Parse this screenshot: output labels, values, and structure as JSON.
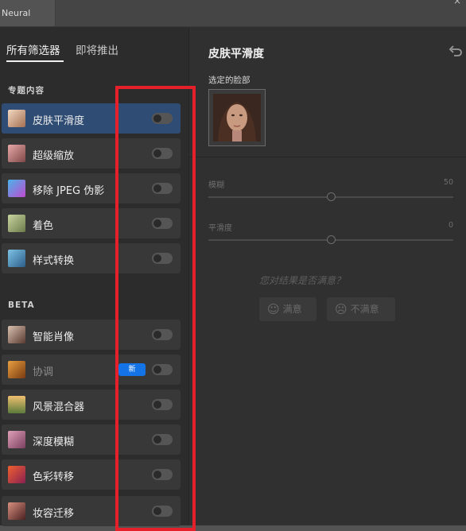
{
  "window": {
    "tab_title": "Neural Filters",
    "close_glyph": "×"
  },
  "left_panel": {
    "tabs": [
      {
        "label": "所有筛选器"
      },
      {
        "label": "即将推出"
      }
    ],
    "featured_section": "专题内容",
    "featured": [
      {
        "label": "皮肤平滑度",
        "icon": "skin-smoothing-icon",
        "selected": true
      },
      {
        "label": "超级缩放",
        "icon": "super-zoom-icon"
      },
      {
        "label": "移除 JPEG 伪影",
        "icon": "jpeg-artifacts-icon"
      },
      {
        "label": "着色",
        "icon": "colorize-icon"
      },
      {
        "label": "样式转换",
        "icon": "style-transfer-icon"
      }
    ],
    "beta_section": "BETA",
    "beta": [
      {
        "label": "智能肖像",
        "icon": "smart-portrait-icon"
      },
      {
        "label": "协调",
        "icon": "harmonization-icon",
        "badge": "新",
        "dimmed": true
      },
      {
        "label": "风景混合器",
        "icon": "landscape-mixer-icon"
      },
      {
        "label": "深度模糊",
        "icon": "depth-blur-icon"
      },
      {
        "label": "色彩转移",
        "icon": "color-transfer-icon"
      },
      {
        "label": "妆容迁移",
        "icon": "makeup-transfer-icon"
      }
    ]
  },
  "right_panel": {
    "title": "皮肤平滑度",
    "undo_icon": "undo-icon",
    "face_label": "选定的脸部",
    "sliders": [
      {
        "label": "模糊",
        "value": "50",
        "fraction": 0.5
      },
      {
        "label": "平滑度",
        "value": "0",
        "fraction": 0.5
      }
    ],
    "feedback_question": "您对结果是否满意？",
    "feedback_buttons": [
      {
        "label": "满意",
        "icon": "smile-icon"
      },
      {
        "label": "不满意",
        "icon": "frown-icon"
      }
    ]
  },
  "colors": {
    "selected_row": "#2f4d74",
    "badge": "#1473e6",
    "highlight_box": "#e5202b"
  }
}
